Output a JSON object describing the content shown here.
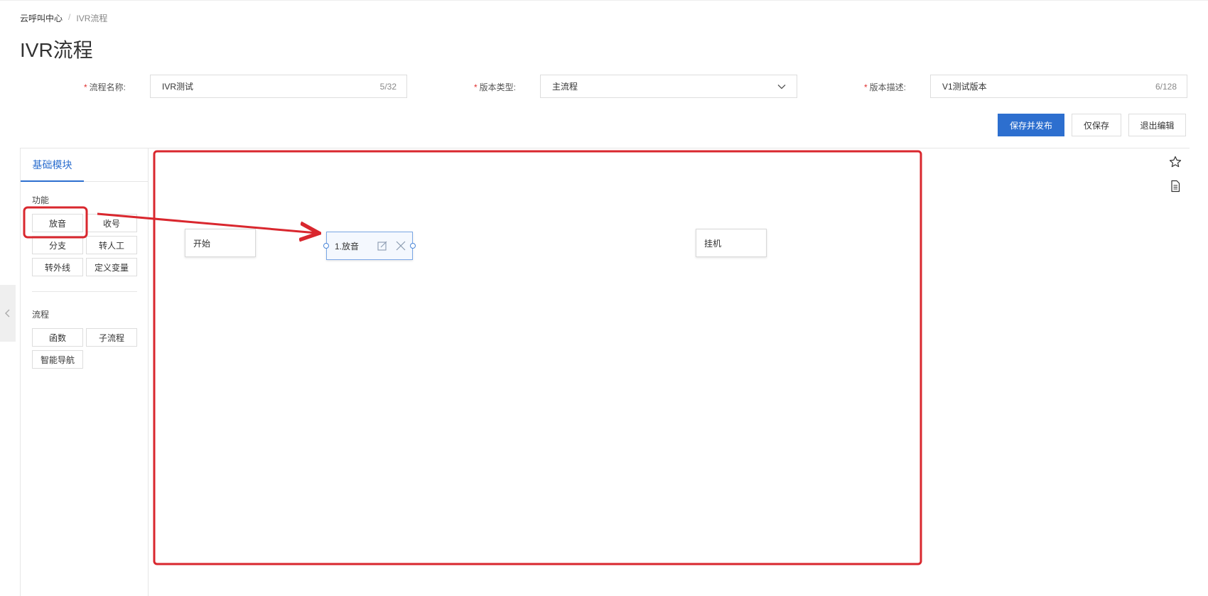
{
  "breadcrumb": {
    "root": "云呼叫中心",
    "separator": "/",
    "current": "IVR流程"
  },
  "page_title": "IVR流程",
  "form": {
    "required_mark": "*",
    "flow_name": {
      "label": "流程名称:",
      "value": "IVR测试",
      "count": "5/32"
    },
    "version_type": {
      "label": "版本类型:",
      "value": "主流程"
    },
    "version_desc": {
      "label": "版本描述:",
      "value": "V1测试版本",
      "count": "6/128"
    }
  },
  "actions": {
    "save_publish": "保存并发布",
    "save_only": "仅保存",
    "exit_edit": "退出编辑"
  },
  "sidebar": {
    "tab": "基础模块",
    "function_group": {
      "label": "功能",
      "items": [
        "放音",
        "收号",
        "分支",
        "转人工",
        "转外线",
        "定义变量"
      ]
    },
    "flow_group": {
      "label": "流程",
      "items": [
        "函数",
        "子流程",
        "智能导航"
      ]
    }
  },
  "canvas": {
    "nodes": {
      "start": "开始",
      "play": "1.放音",
      "hangup": "挂机"
    }
  },
  "colors": {
    "primary": "#2d6fcf",
    "required": "#e0302f",
    "annotation": "#d9272e"
  }
}
